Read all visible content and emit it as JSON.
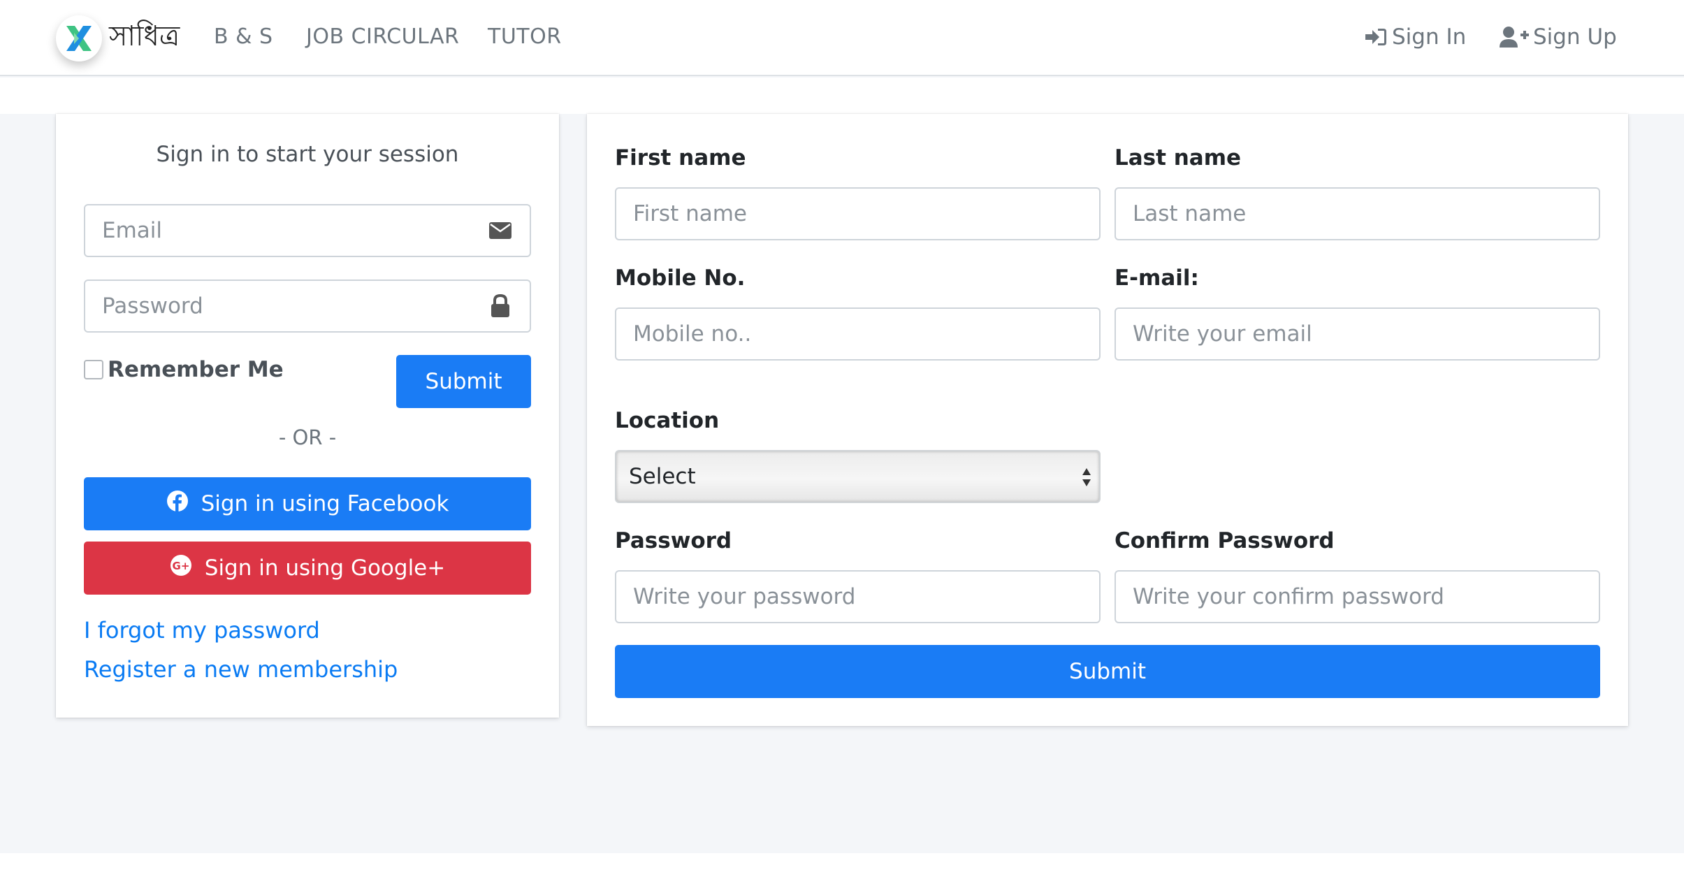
{
  "colors": {
    "primary": "#1a7cf5",
    "facebook": "#1a7cf5",
    "google": "#dc3545",
    "link": "#0a7bf3"
  },
  "navbar": {
    "brand": "সাধিত্র",
    "links": [
      "B & S",
      "JOB CIRCULAR",
      "TUTOR"
    ],
    "sign_in": "Sign In",
    "sign_up": "Sign Up"
  },
  "login": {
    "message": "Sign in to start your session",
    "email_placeholder": "Email",
    "password_placeholder": "Password",
    "remember": "Remember Me",
    "submit": "Submit",
    "or": "- OR -",
    "facebook": "Sign in using Facebook",
    "google": "Sign in using Google+",
    "forgot": "I forgot my password",
    "register": "Register a new membership"
  },
  "register": {
    "first_name_label": "First name",
    "first_name_placeholder": "First name",
    "last_name_label": "Last name",
    "last_name_placeholder": "Last name",
    "mobile_label": "Mobile No.",
    "mobile_placeholder": "Mobile no..",
    "email_label": "E-mail:",
    "email_placeholder": "Write your email",
    "location_label": "Location",
    "location_selected": "Select",
    "password_label": "Password",
    "password_placeholder": "Write your password",
    "confirm_label": "Confirm Password",
    "confirm_placeholder": "Write your confirm password",
    "submit": "Submit"
  }
}
